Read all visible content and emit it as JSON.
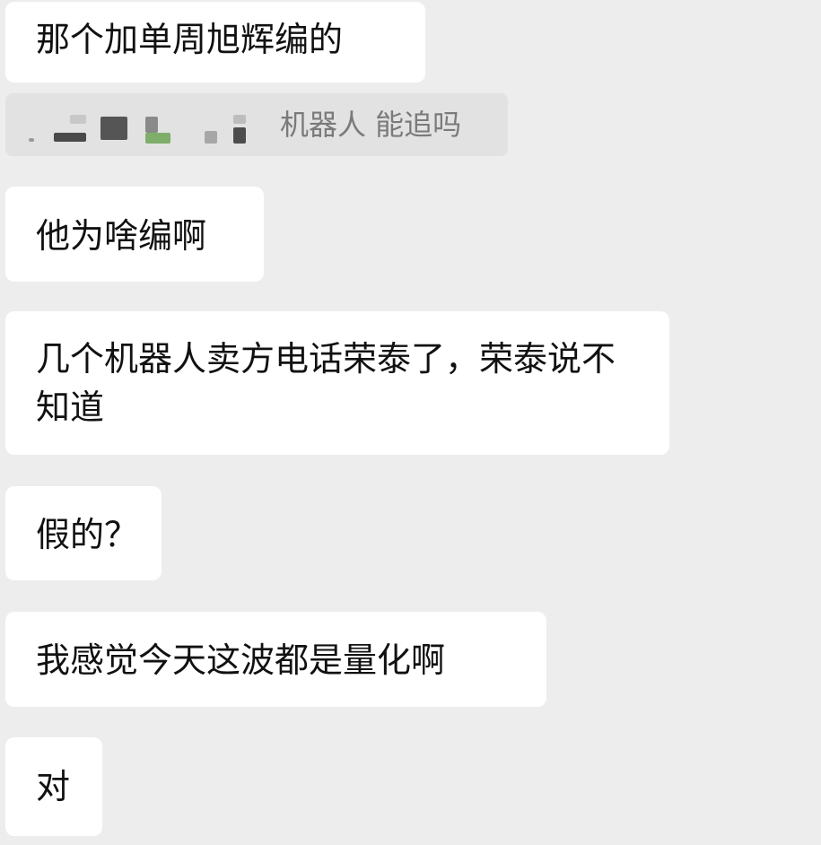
{
  "messages": [
    {
      "text": "那个加单周旭辉编的"
    },
    {
      "text": "他为啥编啊"
    },
    {
      "text": "几个机器人卖方电话荣泰了，荣泰说不知道"
    },
    {
      "text": "假的？"
    },
    {
      "text": "我感觉今天这波都是量化啊"
    },
    {
      "text": "对"
    }
  ],
  "quote": {
    "text": "机器人 能追吗",
    "sender_redacted": true
  },
  "colors": {
    "background": "#ededed",
    "bubble": "#ffffff",
    "quote_background": "#e2e2e2",
    "text": "#111111",
    "quote_text": "#7a7a7a"
  }
}
